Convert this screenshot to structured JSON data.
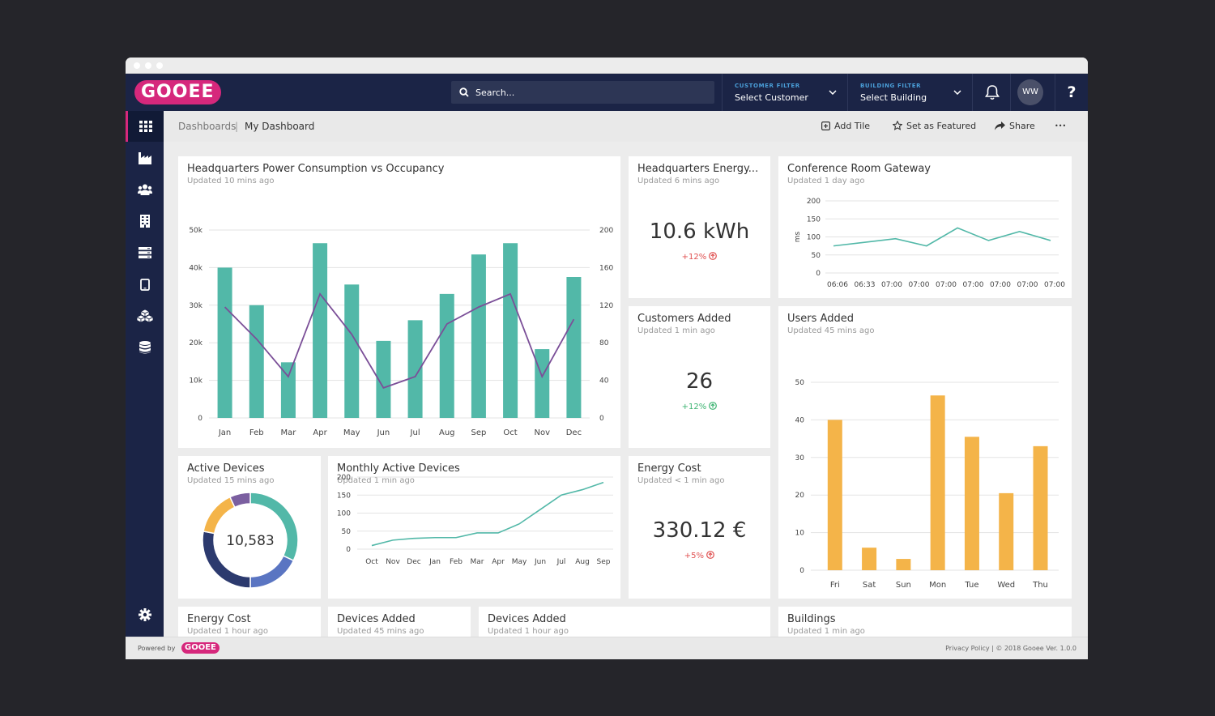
{
  "app": {
    "logo_text": "GOOEE",
    "powered_by": "Powered by",
    "footer_logo": "GOOEE"
  },
  "search": {
    "placeholder": "Search..."
  },
  "customer_filter": {
    "label": "CUSTOMER FILTER",
    "value": "Select Customer"
  },
  "building_filter": {
    "label": "BUILDING FILTER",
    "value": "Select Building"
  },
  "user": {
    "initials": "WW"
  },
  "help_label": "?",
  "breadcrumb": {
    "root": "Dashboards",
    "separator": "|",
    "current": "My Dashboard"
  },
  "actions": {
    "add_tile": "Add Tile",
    "set_featured": "Set as Featured",
    "share": "Share",
    "more": "•••"
  },
  "sidebar": [
    {
      "icon": "dashboard-grid-icon"
    },
    {
      "icon": "factory-icon"
    },
    {
      "icon": "users-icon"
    },
    {
      "icon": "building-icon"
    },
    {
      "icon": "server-rack-icon"
    },
    {
      "icon": "tablet-icon"
    },
    {
      "icon": "cubes-icon"
    },
    {
      "icon": "database-icon"
    },
    {
      "icon": "gear-icon"
    }
  ],
  "tiles": {
    "hq_power": {
      "title": "Headquarters Power Consumption vs Occupancy",
      "updated": "Updated 10 mins ago"
    },
    "hq_energy": {
      "title": "Headquarters Energy...",
      "updated": "Updated 6 mins ago",
      "value": "10.6 kWh",
      "change": "+12%"
    },
    "conference": {
      "title": "Conference Room Gateway",
      "updated": "Updated 1 day ago"
    },
    "customers": {
      "title": "Customers Added",
      "updated": "Updated 1 min ago",
      "value": "26",
      "change": "+12%"
    },
    "users": {
      "title": "Users Added",
      "updated": "Updated 45 mins ago"
    },
    "active_devices": {
      "title": "Active Devices",
      "updated": "Updated 15 mins ago"
    },
    "monthly_devices": {
      "title": "Monthly Active Devices",
      "updated": "Updated 1 min ago"
    },
    "energy_cost": {
      "title": "Energy Cost",
      "updated": "Updated < 1 min ago",
      "value": "330.12 €",
      "change": "+5%"
    },
    "energy_cost_2": {
      "title": "Energy Cost",
      "updated": "Updated 1 hour ago"
    },
    "devices_added_1": {
      "title": "Devices Added",
      "updated": "Updated 45 mins ago"
    },
    "devices_added_2": {
      "title": "Devices Added",
      "updated": "Updated 1 hour ago"
    },
    "buildings": {
      "title": "Buildings",
      "updated": "Updated 1 min ago"
    }
  },
  "footer": {
    "right": "Privacy Policy  |  © 2018 Gooee Ver. 1.0.0"
  },
  "colors": {
    "teal": "#52b8a8",
    "purple": "#7b4f98",
    "orange": "#f4b449",
    "navy": "#1b2446",
    "pink": "#d6287c",
    "red": "#e05050",
    "green": "#3cb371"
  },
  "chart_data": [
    {
      "id": "hq_power",
      "type": "bar",
      "categories": [
        "Jan",
        "Feb",
        "Mar",
        "Apr",
        "May",
        "Jun",
        "Jul",
        "Aug",
        "Sep",
        "Oct",
        "Nov",
        "Dec"
      ],
      "series": [
        {
          "values": [
            40000,
            30000,
            14800,
            46500,
            35500,
            20500,
            26000,
            33000,
            43500,
            46500,
            18300,
            37500
          ],
          "axis": "left"
        },
        {
          "type": "line",
          "values": [
            118,
            84,
            44,
            132,
            89,
            32,
            44,
            100,
            118,
            132,
            44,
            105
          ],
          "axis": "right"
        }
      ],
      "yticks_left": [
        "0",
        "10k",
        "20k",
        "30k",
        "40k",
        "50k"
      ],
      "yticks_right": [
        "0",
        "40",
        "80",
        "120",
        "160",
        "200"
      ],
      "ylim_left": [
        0,
        50000
      ],
      "ylim_right": [
        0,
        200
      ]
    },
    {
      "id": "conference",
      "type": "line",
      "categories": [
        "06:06",
        "06:33",
        "07:00",
        "07:00",
        "07:00",
        "07:00",
        "07:00",
        "07:00",
        "07:00"
      ],
      "values": [
        75,
        85,
        95,
        75,
        125,
        90,
        115,
        90
      ],
      "ylabel": "ms",
      "yticks": [
        "0",
        "50",
        "100",
        "150",
        "200"
      ],
      "ylim": [
        0,
        200
      ]
    },
    {
      "id": "users",
      "type": "bar",
      "categories": [
        "Fri",
        "Sat",
        "Sun",
        "Mon",
        "Tue",
        "Wed",
        "Thu"
      ],
      "values": [
        40,
        6,
        3,
        46.5,
        35.5,
        20.5,
        33
      ],
      "yticks": [
        "0",
        "10",
        "20",
        "30",
        "40",
        "50"
      ],
      "ylim": [
        0,
        50
      ]
    },
    {
      "id": "active_devices",
      "type": "pie",
      "center_label": "10,583",
      "slices": [
        {
          "value": 32,
          "color": "#52b8a8"
        },
        {
          "value": 18,
          "color": "#5a75c2"
        },
        {
          "value": 28,
          "color": "#2c3a6e"
        },
        {
          "value": 15,
          "color": "#f4b449"
        },
        {
          "value": 7,
          "color": "#7b5fa0"
        }
      ]
    },
    {
      "id": "monthly_devices",
      "type": "line",
      "categories": [
        "Oct",
        "Nov",
        "Dec",
        "Jan",
        "Feb",
        "Mar",
        "Apr",
        "May",
        "Jun",
        "Jul",
        "Aug",
        "Sep"
      ],
      "values": [
        10,
        25,
        30,
        32,
        32,
        45,
        45,
        70,
        110,
        150,
        165,
        185
      ],
      "yticks": [
        "0",
        "50",
        "100",
        "150",
        "200"
      ],
      "ylim": [
        0,
        200
      ]
    }
  ]
}
